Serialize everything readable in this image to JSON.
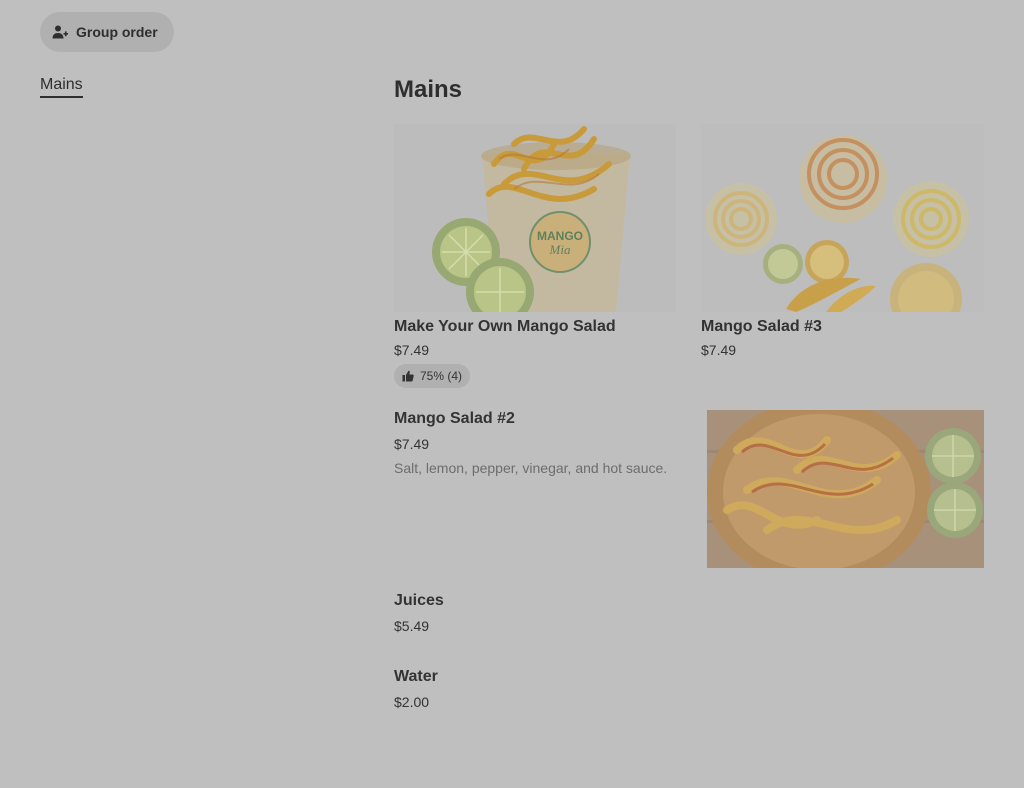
{
  "header": {
    "group_order_label": "Group order",
    "group_order_icon": "person-add-icon"
  },
  "nav": {
    "categories": [
      {
        "label": "Mains",
        "active": true
      }
    ]
  },
  "menu": {
    "section_title": "Mains",
    "items": [
      {
        "name": "Make Your Own Mango Salad",
        "price": "$7.49",
        "rating": "75% (4)",
        "rating_icon": "thumbs-up-icon",
        "photo": "mango-salad-cup-photo"
      },
      {
        "name": "Mango Salad #3",
        "price": "$7.49",
        "photo": "mango-salad-bowls-photo"
      },
      {
        "name": "Mango Salad #2",
        "price": "$7.49",
        "description": "Salt, lemon, pepper, vinegar, and hot sauce.",
        "photo": "mango-salad-plate-photo"
      },
      {
        "name": "Juices",
        "price": "$5.49"
      },
      {
        "name": "Water",
        "price": "$2.00"
      }
    ]
  }
}
